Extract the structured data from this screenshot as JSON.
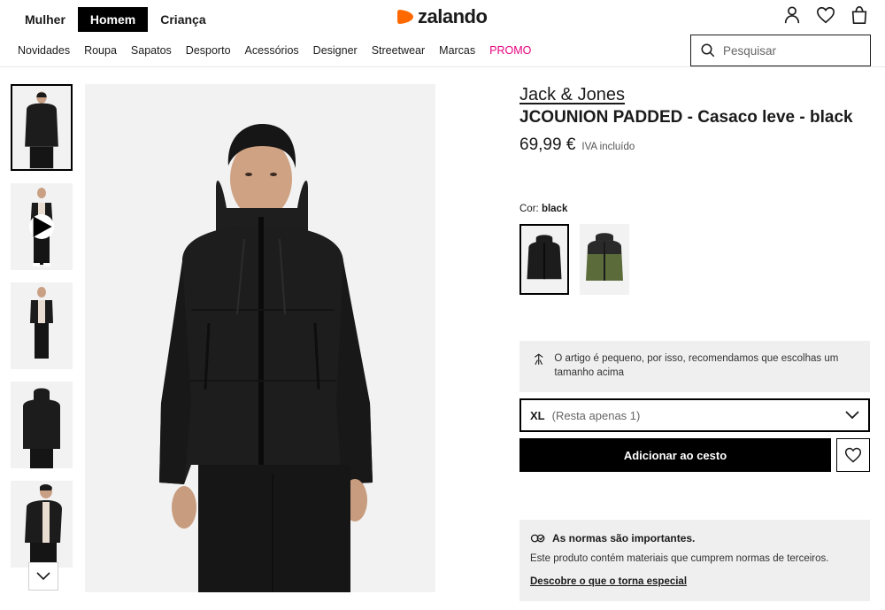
{
  "header": {
    "gender_tabs": [
      {
        "label": "Mulher",
        "active": false
      },
      {
        "label": "Homem",
        "active": true
      },
      {
        "label": "Criança",
        "active": false
      }
    ],
    "logo_text": "zalando",
    "brand_color": "#ff6900",
    "icons": [
      "user-icon",
      "heart-icon",
      "bag-icon"
    ]
  },
  "nav": {
    "items": [
      {
        "label": "Novidades"
      },
      {
        "label": "Roupa"
      },
      {
        "label": "Sapatos"
      },
      {
        "label": "Desporto"
      },
      {
        "label": "Acessórios"
      },
      {
        "label": "Designer"
      },
      {
        "label": "Streetwear"
      },
      {
        "label": "Marcas"
      },
      {
        "label": "PROMO"
      }
    ],
    "promo_color": "#e6007e"
  },
  "search": {
    "placeholder": "Pesquisar"
  },
  "gallery": {
    "thumbnail_count": 5,
    "selected_index": 0,
    "video_thumbnail_index": 1
  },
  "product": {
    "brand": "Jack & Jones",
    "name": "JCOUNION PADDED - Casaco leve - black",
    "price": "69,99 €",
    "vat_note": "IVA incluído",
    "color_label": "Cor:",
    "color_value": "black",
    "swatches": [
      {
        "color": "black",
        "hex": "#1a1a1a",
        "selected": true
      },
      {
        "color": "green",
        "hex": "#5b6b3a",
        "selected": false
      }
    ]
  },
  "size_advice": {
    "text": "O artigo é pequeno, por isso, recomendamos que escolhas um tamanho acima"
  },
  "size_select": {
    "size": "XL",
    "availability": "(Resta apenas 1)"
  },
  "actions": {
    "add_to_cart": "Adicionar ao cesto"
  },
  "norms": {
    "title": "As normas são importantes.",
    "description": "Este produto contém materiais que cumprem normas de terceiros.",
    "link": "Descobre o que o torna especial"
  }
}
